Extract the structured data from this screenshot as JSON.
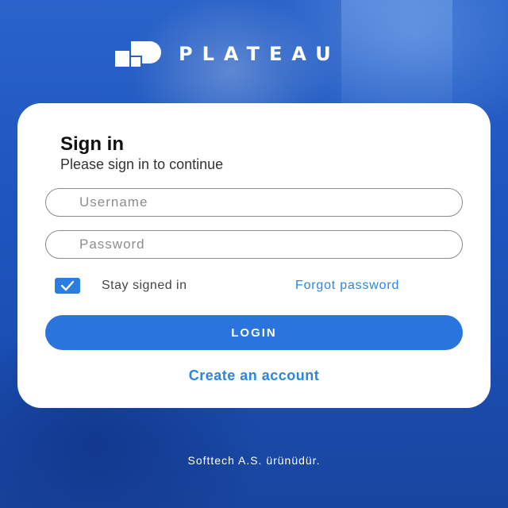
{
  "brand": {
    "name": "PLATEAU",
    "icon": "plateau-logo-icon"
  },
  "card": {
    "title": "Sign in",
    "subtitle": "Please sign in to continue",
    "username_placeholder": "Username",
    "password_placeholder": "Password",
    "stay_signed_in_label": "Stay signed in",
    "stay_signed_in_checked": true,
    "forgot_password_label": "Forgot password",
    "login_label": "LOGIN",
    "create_account_label": "Create an account"
  },
  "footer": {
    "text": "Softtech A.S. ürünüdür."
  },
  "colors": {
    "accent": "#2a74dd",
    "link": "#2a86e0",
    "background": "#1f5bc4"
  }
}
